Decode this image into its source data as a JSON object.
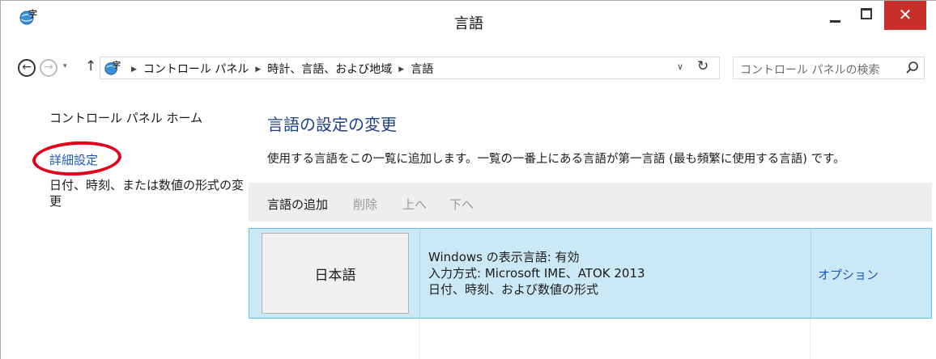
{
  "window": {
    "title": "言語",
    "close_label": "✕"
  },
  "nav": {
    "back_glyph": "←",
    "forward_glyph": "→",
    "recent_glyph": "▾",
    "up_glyph": "↑"
  },
  "address": {
    "breadcrumbs": [
      "コントロール パネル",
      "時計、言語、および地域",
      "言語"
    ],
    "separator": "▶",
    "dropdown_glyph": "∨",
    "refresh_glyph": "↻"
  },
  "search": {
    "placeholder": "コントロール パネルの検索"
  },
  "sidebar": {
    "home": "コントロール パネル ホーム",
    "advanced": "詳細設定",
    "datetime": "日付、時刻、または数値の形式の変更"
  },
  "main": {
    "title": "言語の設定の変更",
    "description": "使用する言語をこの一覧に追加します。一覧の一番上にある言語が第一言語 (最も頻繁に使用する言語) です。",
    "toolbar": {
      "add": "言語の追加",
      "remove": "削除",
      "up": "上へ",
      "down": "下へ"
    },
    "languages": [
      {
        "name": "日本語",
        "display_status": "Windows の表示言語: 有効",
        "input_methods": "入力方式: Microsoft IME、ATOK 2013",
        "formats": "日付、時刻、および数値の形式",
        "options": "オプション"
      }
    ]
  },
  "colors": {
    "accent_link": "#1c58b5",
    "title_blue": "#1f3f86",
    "close_red": "#c7302b",
    "selection_fill": "#cbe8f6",
    "selection_border": "#5fc0ee",
    "highlight_circle": "#e3001b"
  }
}
